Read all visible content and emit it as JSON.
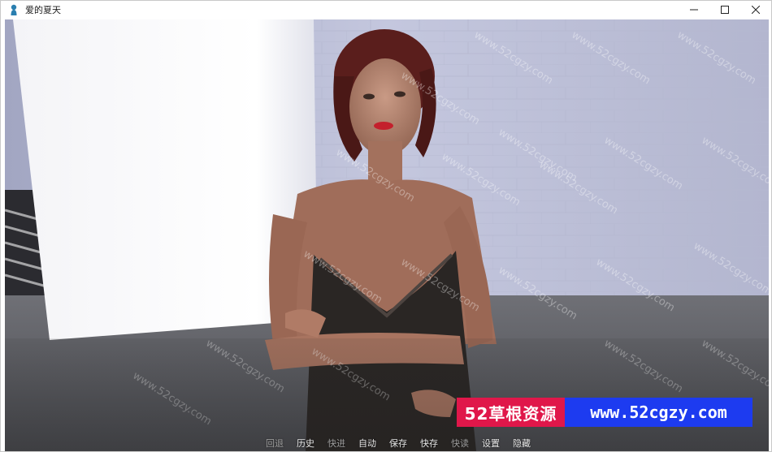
{
  "window": {
    "title": "爱的夏天",
    "icon": "app-icon",
    "controls": [
      "minimize-icon",
      "maximize-icon",
      "close-icon"
    ]
  },
  "quick_menu": [
    {
      "label": "回退",
      "enabled": false
    },
    {
      "label": "历史",
      "enabled": true
    },
    {
      "label": "快进",
      "enabled": false
    },
    {
      "label": "自动",
      "enabled": true
    },
    {
      "label": "保存",
      "enabled": true
    },
    {
      "label": "快存",
      "enabled": true
    },
    {
      "label": "快读",
      "enabled": false
    },
    {
      "label": "设置",
      "enabled": true
    },
    {
      "label": "隐藏",
      "enabled": true
    }
  ],
  "watermark": {
    "text": "www.52cgzy.com"
  },
  "banner": {
    "left_text": "52草根资源",
    "right_text": "www.52cgzy.com",
    "left_color": "#e0174a",
    "right_color": "#1d3bf0"
  }
}
